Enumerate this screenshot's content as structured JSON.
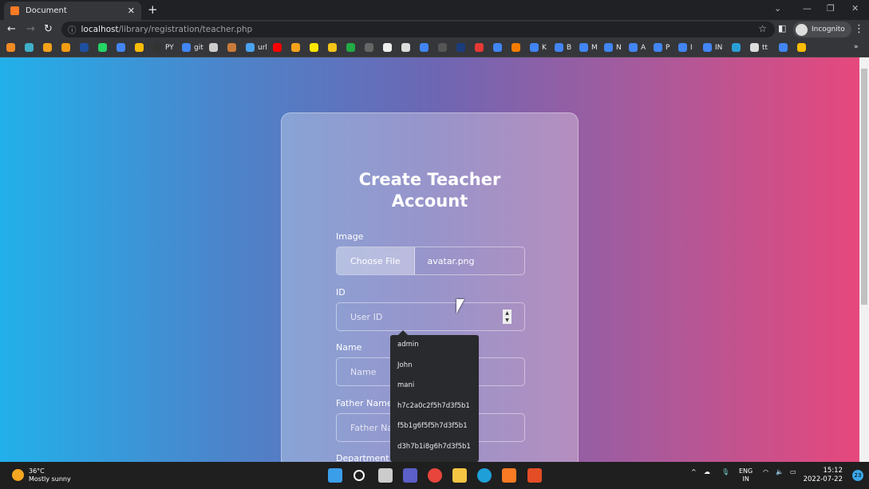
{
  "browser": {
    "tab_title": "Document",
    "url_host": "localhost",
    "url_path": "/library/registration/teacher.php",
    "profile": "Incognito"
  },
  "bookmarks": [
    {
      "label": "",
      "color": "#f08a24"
    },
    {
      "label": "",
      "color": "#3fb0c9"
    },
    {
      "label": "",
      "color": "#f4a21b"
    },
    {
      "label": "",
      "color": "#f39c12"
    },
    {
      "label": "",
      "color": "#1e4fa0"
    },
    {
      "label": "",
      "color": "#25d366"
    },
    {
      "label": "",
      "color": "#4285f4"
    },
    {
      "label": "",
      "color": "#fbbc04"
    },
    {
      "label": "PY",
      "color": "#333"
    },
    {
      "label": "git",
      "color": "#4285f4"
    },
    {
      "label": "",
      "color": "#ccc"
    },
    {
      "label": "",
      "color": "#c97a3a"
    },
    {
      "label": "url",
      "color": "#4aa3f0"
    },
    {
      "label": "",
      "color": "#ff0000"
    },
    {
      "label": "",
      "color": "#f7a21b"
    },
    {
      "label": "",
      "color": "#ffe600"
    },
    {
      "label": "",
      "color": "#f5c518"
    },
    {
      "label": "",
      "color": "#22aa44"
    },
    {
      "label": "",
      "color": "#666"
    },
    {
      "label": "",
      "color": "#eee"
    },
    {
      "label": "",
      "color": "#ddd"
    },
    {
      "label": "",
      "color": "#4285f4"
    },
    {
      "label": "",
      "color": "#555"
    },
    {
      "label": "",
      "color": "#1a3d7c"
    },
    {
      "label": "",
      "color": "#e53935"
    },
    {
      "label": "",
      "color": "#4285f4"
    },
    {
      "label": "",
      "color": "#f57c00"
    },
    {
      "label": "K",
      "color": "#4285f4"
    },
    {
      "label": "B",
      "color": "#4285f4"
    },
    {
      "label": "M",
      "color": "#4285f4"
    },
    {
      "label": "N",
      "color": "#4285f4"
    },
    {
      "label": "A",
      "color": "#4285f4"
    },
    {
      "label": "P",
      "color": "#4285f4"
    },
    {
      "label": "I",
      "color": "#4285f4"
    },
    {
      "label": "IN",
      "color": "#4285f4"
    },
    {
      "label": "",
      "color": "#2a9fd6"
    },
    {
      "label": "tt",
      "color": "#ddd"
    },
    {
      "label": "",
      "color": "#4285f4"
    },
    {
      "label": "",
      "color": "#fbbc04"
    }
  ],
  "form": {
    "title": "Create Teacher Account",
    "image_label": "Image",
    "choose_file": "Choose File",
    "file_name": "avatar.png",
    "id_label": "ID",
    "id_placeholder": "User ID",
    "name_label": "Name",
    "name_placeholder": "Name",
    "father_label": "Father Name",
    "father_placeholder": "Father Name",
    "department_label": "Department"
  },
  "autocomplete": [
    "admin",
    "John",
    "mani",
    "h7c2a0c2f5h7d3f5b1",
    "f5b1g6f5f5h7d3f5b1",
    "d3h7b1i8g6h7d3f5b1"
  ],
  "taskbar": {
    "temp": "36°C",
    "weather": "Mostly sunny",
    "lang1": "ENG",
    "lang2": "IN",
    "time": "15:12",
    "date": "2022-07-22",
    "notifications": "23"
  }
}
